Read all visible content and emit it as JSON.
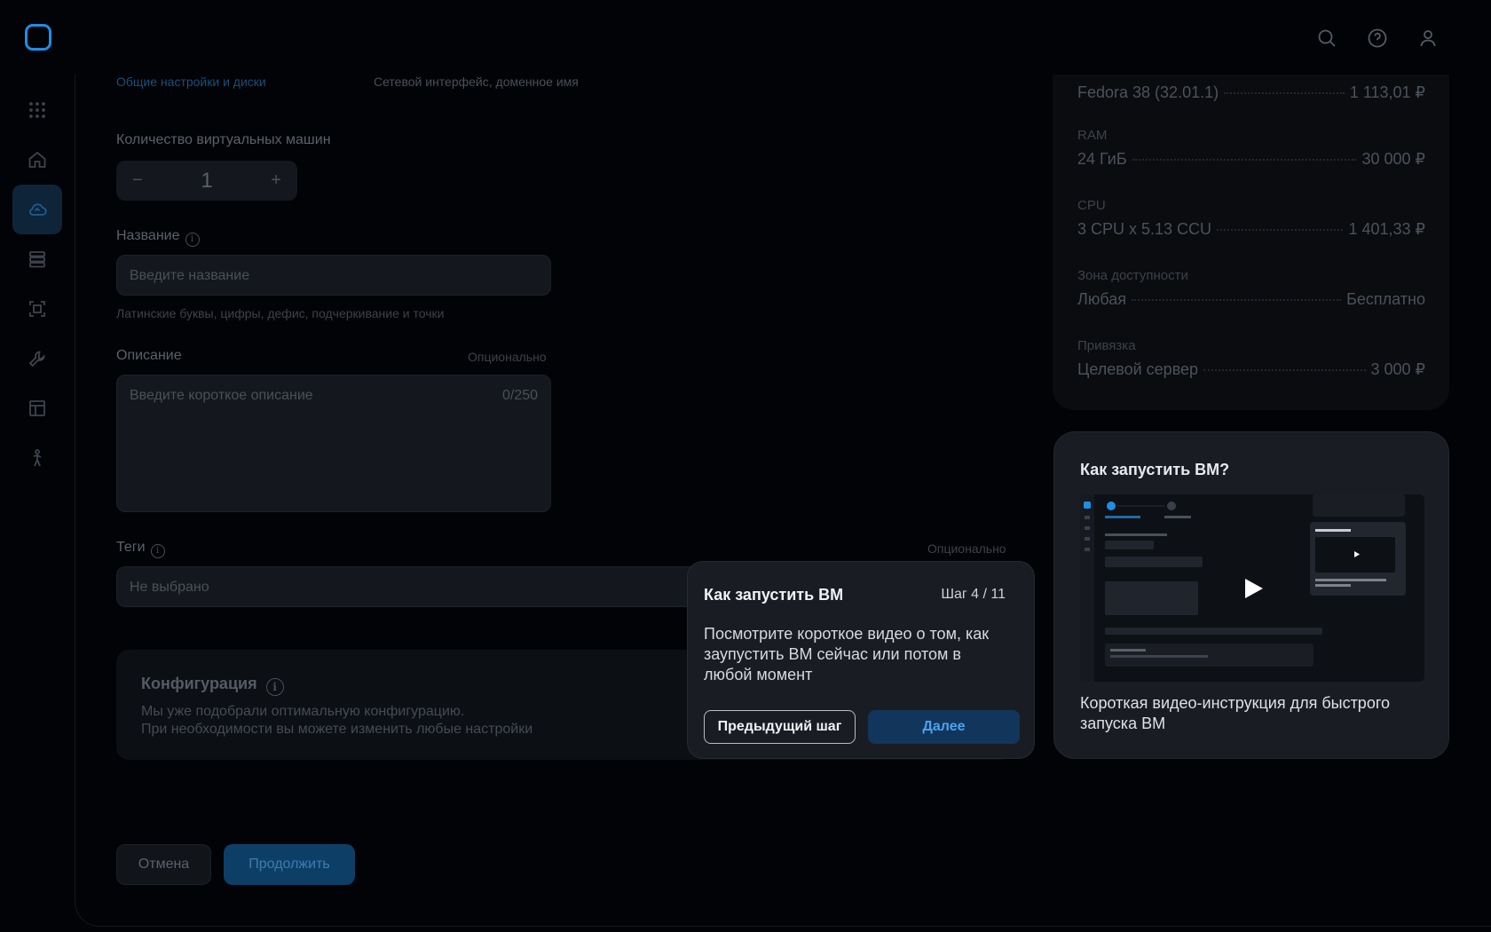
{
  "header": {
    "icons": [
      "search-icon",
      "help-icon",
      "user-icon"
    ]
  },
  "rail": {
    "items": [
      "apps-grid-icon",
      "home-icon",
      "cloud-icon",
      "database-icon",
      "frame-icon",
      "tools-icon",
      "layout-icon",
      "person-icon"
    ],
    "active": "cloud-icon"
  },
  "steps": {
    "current_sub": "Общие настройки и диски",
    "next_sub": "Сетевой интерфейс, доменное имя"
  },
  "form": {
    "vm_count_label": "Количество виртуальных машин",
    "vm_count_value": "1",
    "minus": "−",
    "plus": "+",
    "name_label": "Название",
    "name_placeholder": "Введите название",
    "name_hint": "Латинские буквы, цифры, дефис, подчеркивание и точки",
    "desc_label": "Описание",
    "desc_optional": "Опционально",
    "desc_placeholder": "Введите короткое описание",
    "desc_counter": "0/250",
    "tags_label": "Теги",
    "tags_optional": "Опционально",
    "tags_value": "Не выбрано"
  },
  "config": {
    "title": "Конфигурация",
    "line1": "Мы уже подобрали оптимальную конфигурацию.",
    "line2": "При необходимости вы можете изменить любые настройки"
  },
  "actions": {
    "cancel": "Отмена",
    "continue": "Продолжить"
  },
  "pricing": {
    "os": {
      "name": "Fedora 38 (32.01.1)",
      "price": "1 113,01 ₽"
    },
    "ram": {
      "category": "RAM",
      "name": "24 ГиБ",
      "price": "30 000 ₽"
    },
    "cpu": {
      "category": "CPU",
      "name": "3 CPU x 5.13 CCU",
      "price": "1 401,33 ₽"
    },
    "zone": {
      "category": "Зона доступности",
      "name": "Любая",
      "price": "Бесплатно"
    },
    "binding": {
      "category": "Привязка",
      "name": "Целевой сервер",
      "price": "3 000 ₽"
    }
  },
  "video": {
    "title": "Как запустить ВМ?",
    "caption": "Короткая видео-инструкция для быстрого запуска ВМ"
  },
  "tour": {
    "title": "Как запустить ВМ",
    "step": "Шаг 4 / 11",
    "body": "Посмотрите короткое видео о том, как заупустить ВМ сейчас или потом в любой момент",
    "prev": "Предыдущий шаг",
    "next": "Далее"
  }
}
